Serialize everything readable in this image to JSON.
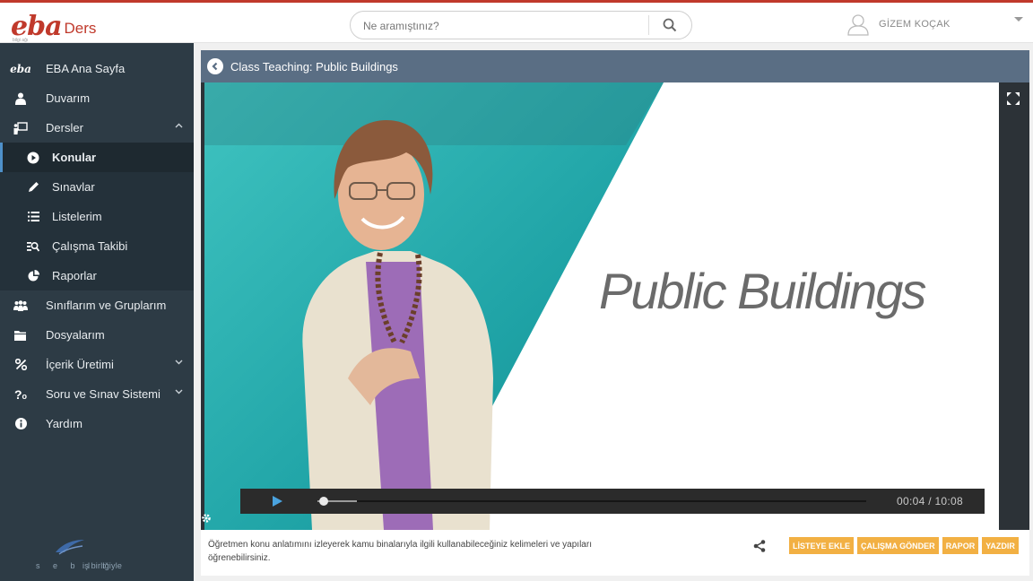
{
  "brand": {
    "logo": "eba",
    "product": "Ders",
    "tagline": "bilgi ağı"
  },
  "search": {
    "placeholder": "Ne aramıştınız?"
  },
  "user": {
    "name": "GİZEM KOÇAK"
  },
  "sidebar": {
    "items": [
      {
        "label": "EBA Ana Sayfa",
        "icon": "eba-icon"
      },
      {
        "label": "Duvarım",
        "icon": "user-icon"
      },
      {
        "label": "Dersler",
        "icon": "presentation-icon",
        "expanded": true
      },
      {
        "label": "Konular",
        "icon": "play-circle-icon",
        "active": true
      },
      {
        "label": "Sınavlar",
        "icon": "pencil-icon"
      },
      {
        "label": "Listelerim",
        "icon": "list-icon"
      },
      {
        "label": "Çalışma Takibi",
        "icon": "tracking-icon"
      },
      {
        "label": "Raporlar",
        "icon": "pie-chart-icon"
      },
      {
        "label": "Sınıflarım ve Gruplarım",
        "icon": "users-icon"
      },
      {
        "label": "Dosyalarım",
        "icon": "folder-icon"
      },
      {
        "label": "İçerik Üretimi",
        "icon": "percent-icon"
      },
      {
        "label": "Soru ve Sınav Sistemi",
        "icon": "question-icon"
      },
      {
        "label": "Yardım",
        "icon": "info-icon"
      }
    ],
    "partner": {
      "text": "iş birliğiyle",
      "logo_letters": "s e b l t"
    }
  },
  "video": {
    "title": "Class Teaching: Public Buildings",
    "slide_text": "Public Buildings",
    "time": "00:04 / 10:08",
    "progress": 0.0066
  },
  "description": "Öğretmen konu anlatımını izleyerek kamu binalarıyla ilgili kullanabileceğiniz kelimeleri ve yapıları öğrenebilirsiniz.",
  "actions": [
    "LİSTEYE EKLE",
    "ÇALIŞMA GÖNDER",
    "RAPOR",
    "YAZDIR"
  ],
  "colors": {
    "accent": "#f2b043",
    "sidebar": "#2d3b45",
    "header": "#5a6e84",
    "brand": "#c0392b",
    "teal": "#2ab1b3"
  }
}
